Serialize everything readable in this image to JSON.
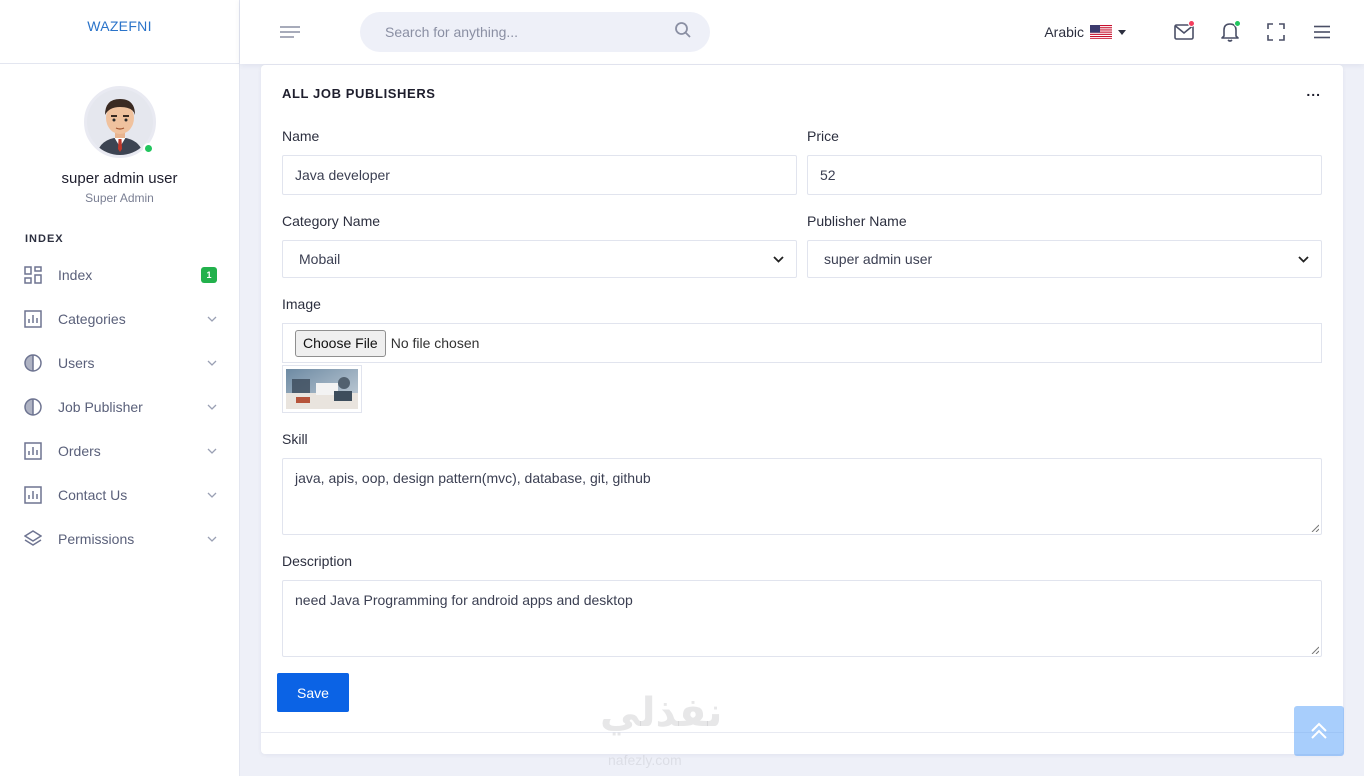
{
  "brand": "WAZEFNI",
  "profile": {
    "name": "super admin user",
    "role": "Super Admin"
  },
  "nav": {
    "section": "INDEX",
    "items": [
      {
        "label": "Index",
        "icon": "dashboard-icon",
        "badge": "1"
      },
      {
        "label": "Categories",
        "icon": "chart-icon"
      },
      {
        "label": "Users",
        "icon": "pie-icon"
      },
      {
        "label": "Job Publisher",
        "icon": "pie-icon"
      },
      {
        "label": "Orders",
        "icon": "chart-icon"
      },
      {
        "label": "Contact Us",
        "icon": "chart-icon"
      },
      {
        "label": "Permissions",
        "icon": "layers-icon"
      }
    ]
  },
  "header": {
    "search_placeholder": "Search for anything...",
    "language": "Arabic",
    "mail_dot_color": "#f43f5e",
    "bell_dot_color": "#22c55e"
  },
  "form": {
    "title": "ALL JOB PUBLISHERS",
    "more": "...",
    "name_label": "Name",
    "name_value": "Java developer",
    "price_label": "Price",
    "price_value": "52",
    "category_label": "Category Name",
    "category_value": "Mobail",
    "publisher_label": "Publisher Name",
    "publisher_value": "super admin user",
    "image_label": "Image",
    "file_button": "Choose File",
    "file_status": "No file chosen",
    "skill_label": "Skill",
    "skill_value": "java, apis, oop, design pattern(mvc), database, git, github",
    "description_label": "Description",
    "description_value": "need Java Programming for android apps and desktop",
    "save_label": "Save"
  },
  "watermark": "نفذلي",
  "watermark_sub": "nafezly.com",
  "colors": {
    "primary": "#0b63e5",
    "brand": "#2a73c9",
    "badge": "#22b14c"
  }
}
